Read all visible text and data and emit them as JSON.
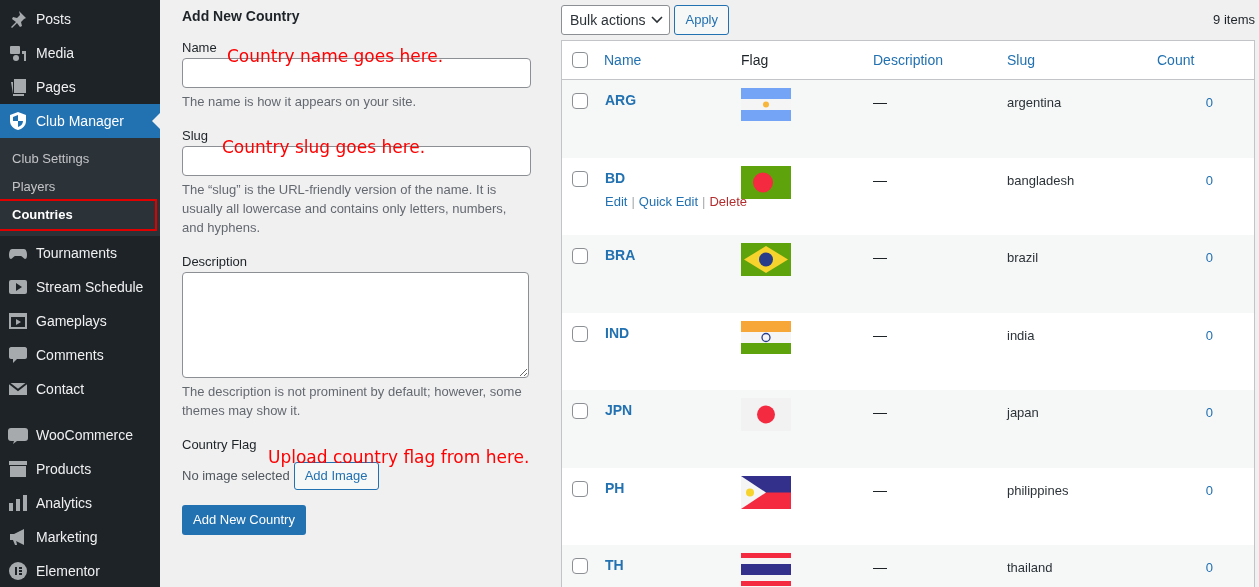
{
  "sidebar": {
    "items": [
      {
        "label": "Posts",
        "kind": "pin",
        "selected": false
      },
      {
        "label": "Media",
        "kind": "media",
        "selected": false
      },
      {
        "label": "Pages",
        "kind": "pages",
        "selected": false
      },
      {
        "label": "Club Manager",
        "kind": "shield",
        "selected": true,
        "children": [
          {
            "label": "Club Settings",
            "selected": false,
            "highlighted": false
          },
          {
            "label": "Players",
            "selected": false,
            "highlighted": false
          },
          {
            "label": "Countries",
            "selected": true,
            "highlighted": true
          }
        ]
      },
      {
        "label": "Tournaments",
        "kind": "gamepad",
        "selected": false
      },
      {
        "label": "Stream Schedule",
        "kind": "play",
        "selected": false
      },
      {
        "label": "Gameplays",
        "kind": "film",
        "selected": false
      },
      {
        "label": "Comments",
        "kind": "comment",
        "selected": false
      },
      {
        "label": "Contact",
        "kind": "mail",
        "selected": false
      },
      {
        "label": "WooCommerce",
        "kind": "woo",
        "selected": false
      },
      {
        "label": "Products",
        "kind": "archive",
        "selected": false
      },
      {
        "label": "Analytics",
        "kind": "bars",
        "selected": false
      },
      {
        "label": "Marketing",
        "kind": "megaphone",
        "selected": false
      },
      {
        "label": "Elementor",
        "kind": "elementor",
        "selected": false
      }
    ]
  },
  "form": {
    "title": "Add New Country",
    "fields": [
      {
        "kind": "text",
        "label": "Name",
        "help": "The name is how it appears on your site."
      },
      {
        "kind": "text",
        "label": "Slug",
        "help": "The “slug” is the URL-friendly version of the name. It is usually all lowercase and contains only letters, numbers, and hyphens."
      },
      {
        "kind": "textarea",
        "label": "Description",
        "help": "The description is not prominent by default; however, some themes may show it."
      },
      {
        "kind": "image",
        "label": "Country Flag",
        "status": "No image selected",
        "button": "Add Image"
      }
    ],
    "submit": "Add New Country"
  },
  "annotations": [
    "Country name goes here.",
    "Country slug goes here.",
    "Upload country flag from here."
  ],
  "toolbar": {
    "bulk_actions": "Bulk actions",
    "apply": "Apply",
    "count": "9 items"
  },
  "table": {
    "select_all_checked": false,
    "columns": [
      "Name",
      "Flag",
      "Description",
      "Slug",
      "Count"
    ],
    "rows": [
      {
        "name": "ARG",
        "kind": "argentina",
        "description": "—",
        "slug": "argentina",
        "count": "0",
        "checked": false
      },
      {
        "name": "BD",
        "kind": "bangladesh",
        "description": "—",
        "slug": "bangladesh",
        "count": "0",
        "checked": false,
        "row_actions": [
          {
            "label": "Edit",
            "kind": "normal",
            "separator": "|"
          },
          {
            "label": "Quick Edit",
            "kind": "normal",
            "separator": "|"
          },
          {
            "label": "Delete",
            "kind": "danger"
          }
        ]
      },
      {
        "name": "BRA",
        "kind": "brazil",
        "description": "—",
        "slug": "brazil",
        "count": "0",
        "checked": false
      },
      {
        "name": "IND",
        "kind": "india",
        "description": "—",
        "slug": "india",
        "count": "0",
        "checked": false
      },
      {
        "name": "JPN",
        "kind": "japan",
        "description": "—",
        "slug": "japan",
        "count": "0",
        "checked": false
      },
      {
        "name": "PH",
        "kind": "philippines",
        "description": "—",
        "slug": "philippines",
        "count": "0",
        "checked": false
      },
      {
        "name": "TH",
        "kind": "thailand",
        "description": "—",
        "slug": "thailand",
        "count": "0",
        "checked": false
      }
    ]
  }
}
